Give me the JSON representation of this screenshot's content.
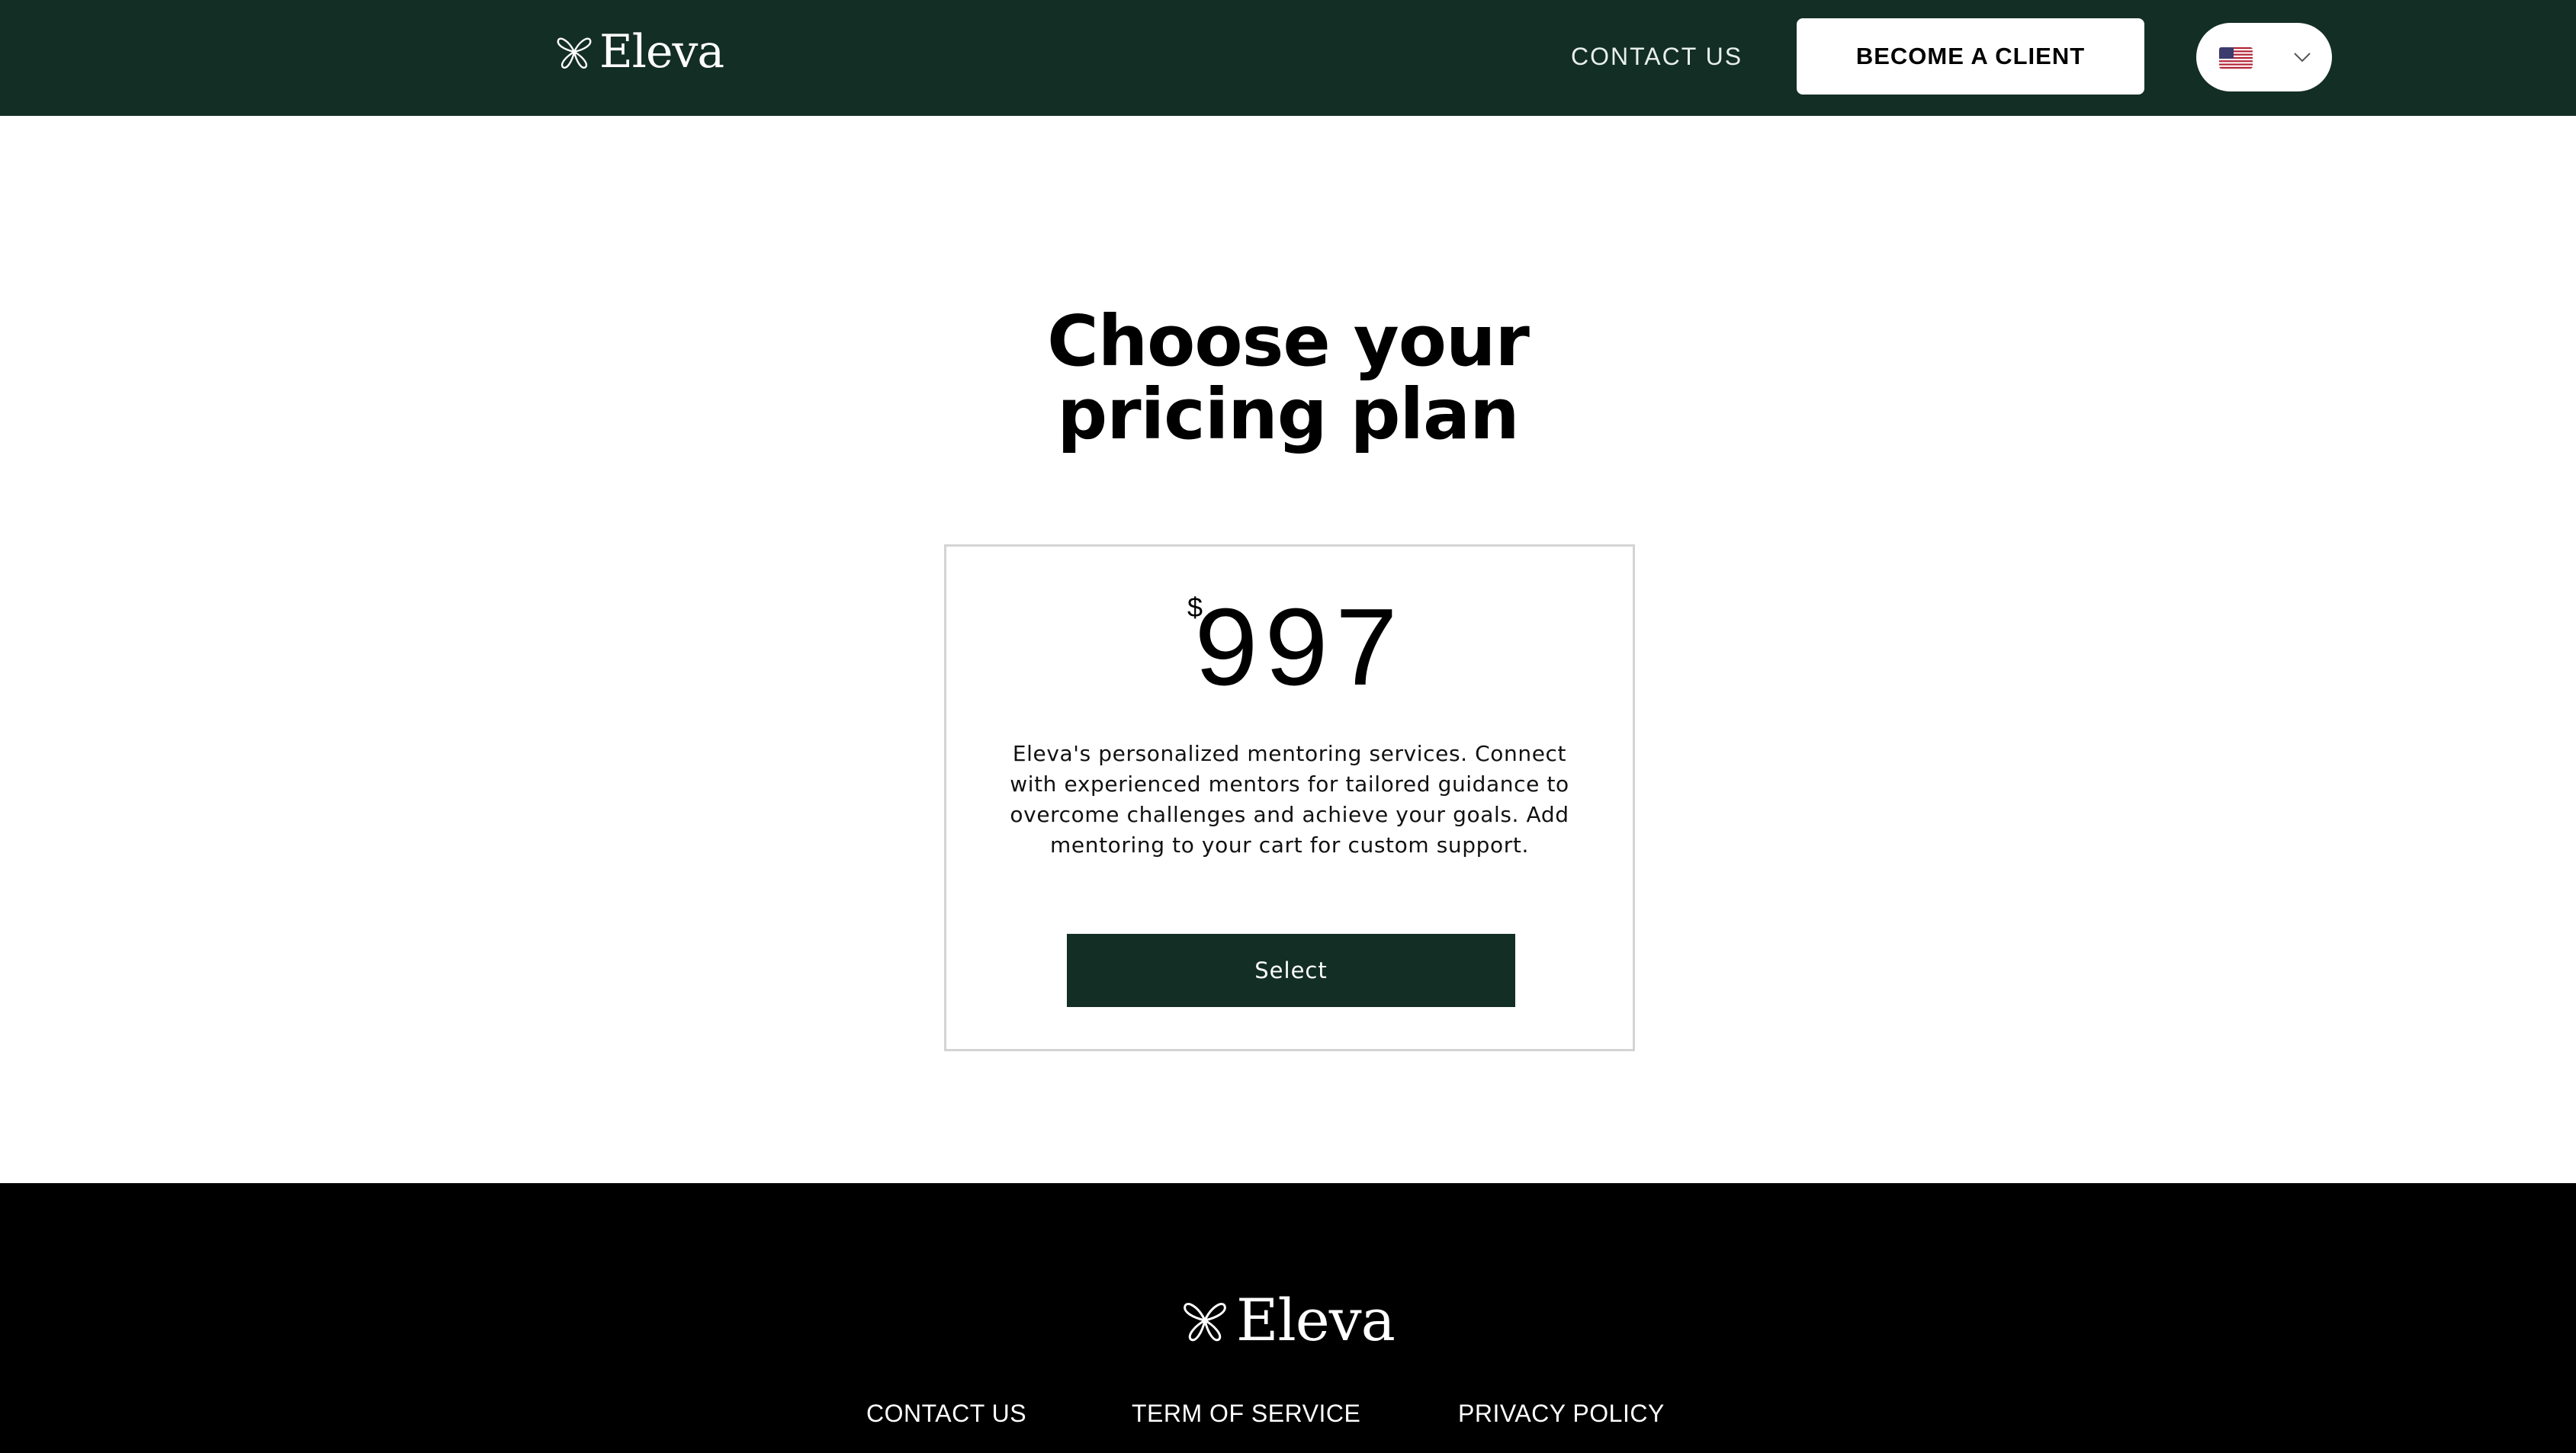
{
  "brand": {
    "name": "Eleva",
    "header_bg_color": "#132e25",
    "footer_bg_color": "#000000"
  },
  "header": {
    "logo_text": "Eleva",
    "logo_icon": "butterfly-icon",
    "nav_contact": "CONTACT US",
    "cta_button": "BECOME A CLIENT",
    "language_selector": {
      "selected_flag": "us-flag-icon",
      "dropdown_icon": "chevron-down-icon"
    }
  },
  "main": {
    "title_line1": "Choose your",
    "title_line2": "pricing plan",
    "plan": {
      "currency": "$",
      "price": "997",
      "description": "Eleva's personalized mentoring services. Connect with experienced mentors for tailored guidance to overcome challenges and achieve your goals. Add mentoring to your cart for custom support.",
      "select_button": "Select"
    }
  },
  "footer": {
    "logo_text": "Eleva",
    "links": [
      "CONTACT US",
      "TERM OF SERVICE",
      "PRIVACY POLICY"
    ]
  }
}
